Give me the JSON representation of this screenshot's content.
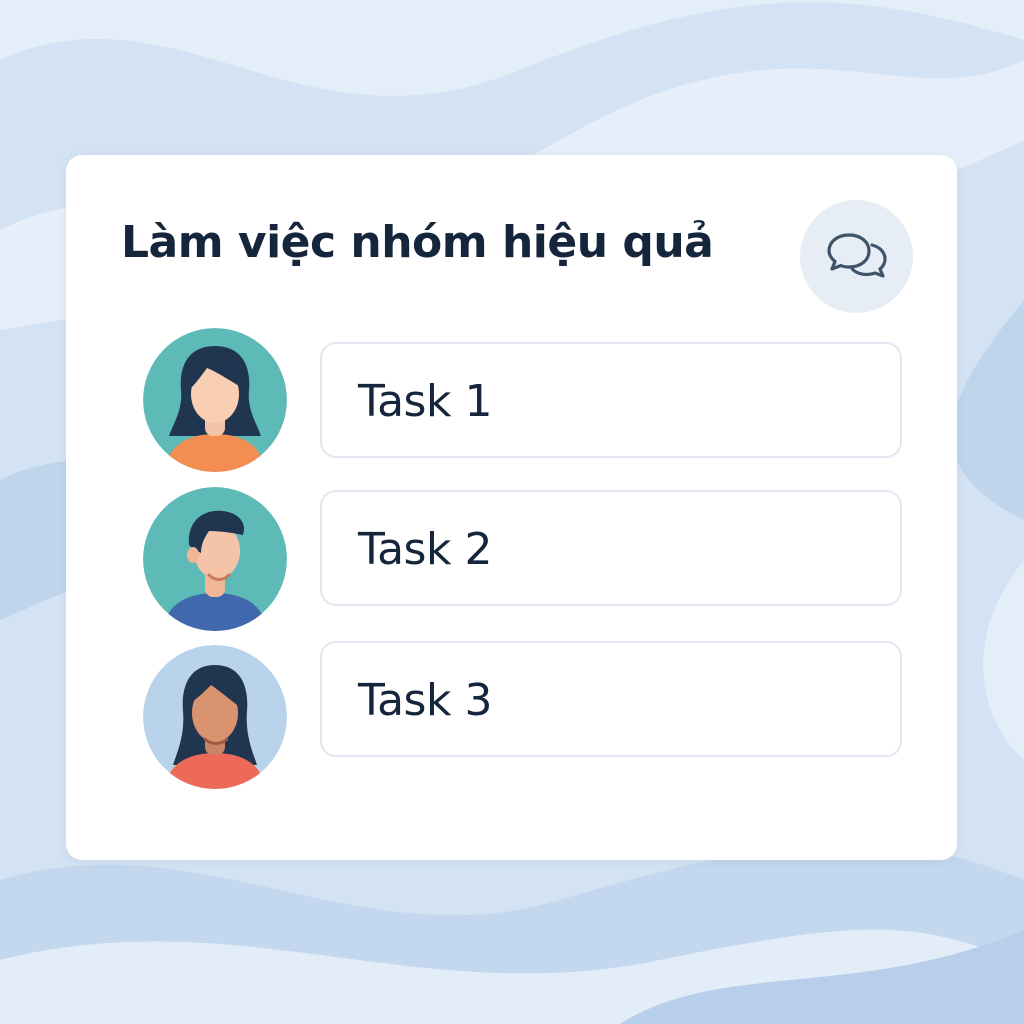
{
  "card": {
    "title": "Làm việc nhóm hiệu quả",
    "chat_icon": "chat-bubbles-icon"
  },
  "tasks": [
    {
      "label": "Task 1",
      "avatar": "woman-avatar-icon"
    },
    {
      "label": "Task 2",
      "avatar": "man-avatar-icon"
    },
    {
      "label": "Task 3",
      "avatar": "woman-avatar-icon"
    }
  ],
  "colors": {
    "background": "#d3e3f3",
    "card": "#ffffff",
    "title_text": "#15253c",
    "task_border": "#e0e7f0",
    "chat_button_bg": "#e6edf5",
    "avatar_teal": "#5dbab7",
    "avatar_light_blue": "#b9d3ea",
    "shirt_orange": "#f38d52",
    "shirt_blue": "#3f68ad",
    "shirt_coral": "#ee6a58"
  }
}
